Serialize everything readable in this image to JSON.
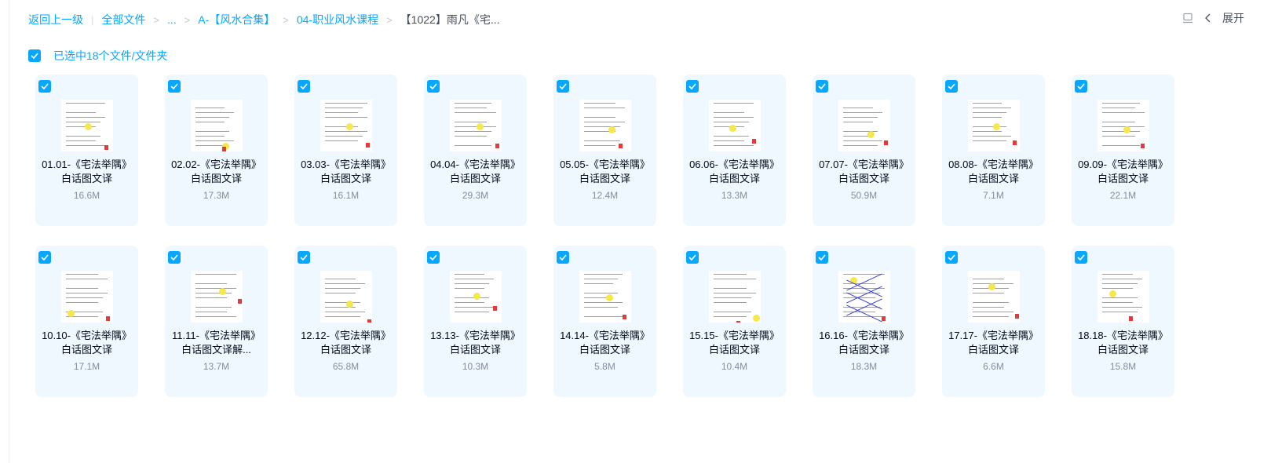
{
  "breadcrumb": {
    "back": "返回上一级",
    "all_files": "全部文件",
    "ellipsis": "...",
    "level1": "A-【风水合集】",
    "level2": "04-职业风水课程",
    "current": "【1022】雨凡《宅..."
  },
  "topright": {
    "expand_label": "展开"
  },
  "selection": {
    "text": "已选中18个文件/文件夹"
  },
  "files": [
    {
      "name": "01.01-《宅法举隅》白话图文译",
      "size": "16.6M"
    },
    {
      "name": "02.02-《宅法举隅》白话图文译",
      "size": "17.3M"
    },
    {
      "name": "03.03-《宅法举隅》白话图文译",
      "size": "16.1M"
    },
    {
      "name": "04.04-《宅法举隅》白话图文译",
      "size": "29.3M"
    },
    {
      "name": "05.05-《宅法举隅》白话图文译",
      "size": "12.4M"
    },
    {
      "name": "06.06-《宅法举隅》白话图文译",
      "size": "13.3M"
    },
    {
      "name": "07.07-《宅法举隅》白话图文译",
      "size": "50.9M"
    },
    {
      "name": "08.08-《宅法举隅》白话图文译",
      "size": "7.1M"
    },
    {
      "name": "09.09-《宅法举隅》白话图文译",
      "size": "22.1M"
    },
    {
      "name": "10.10-《宅法举隅》白话图文译",
      "size": "17.1M"
    },
    {
      "name": "11.11-《宅法举隅》白话图文译解...",
      "size": "13.7M"
    },
    {
      "name": "12.12-《宅法举隅》白话图文译",
      "size": "65.8M"
    },
    {
      "name": "13.13-《宅法举隅》白话图文译",
      "size": "10.3M"
    },
    {
      "name": "14.14-《宅法举隅》白话图文译",
      "size": "5.8M"
    },
    {
      "name": "15.15-《宅法举隅》白话图文译",
      "size": "10.4M"
    },
    {
      "name": "16.16-《宅法举隅》白话图文译",
      "size": "18.3M"
    },
    {
      "name": "17.17-《宅法举隅》白话图文译",
      "size": "6.6M"
    },
    {
      "name": "18.18-《宅法举隅》白话图文译",
      "size": "15.8M"
    }
  ],
  "colors": {
    "accent": "#06a7ff",
    "card_bg": "#eef8fe"
  }
}
